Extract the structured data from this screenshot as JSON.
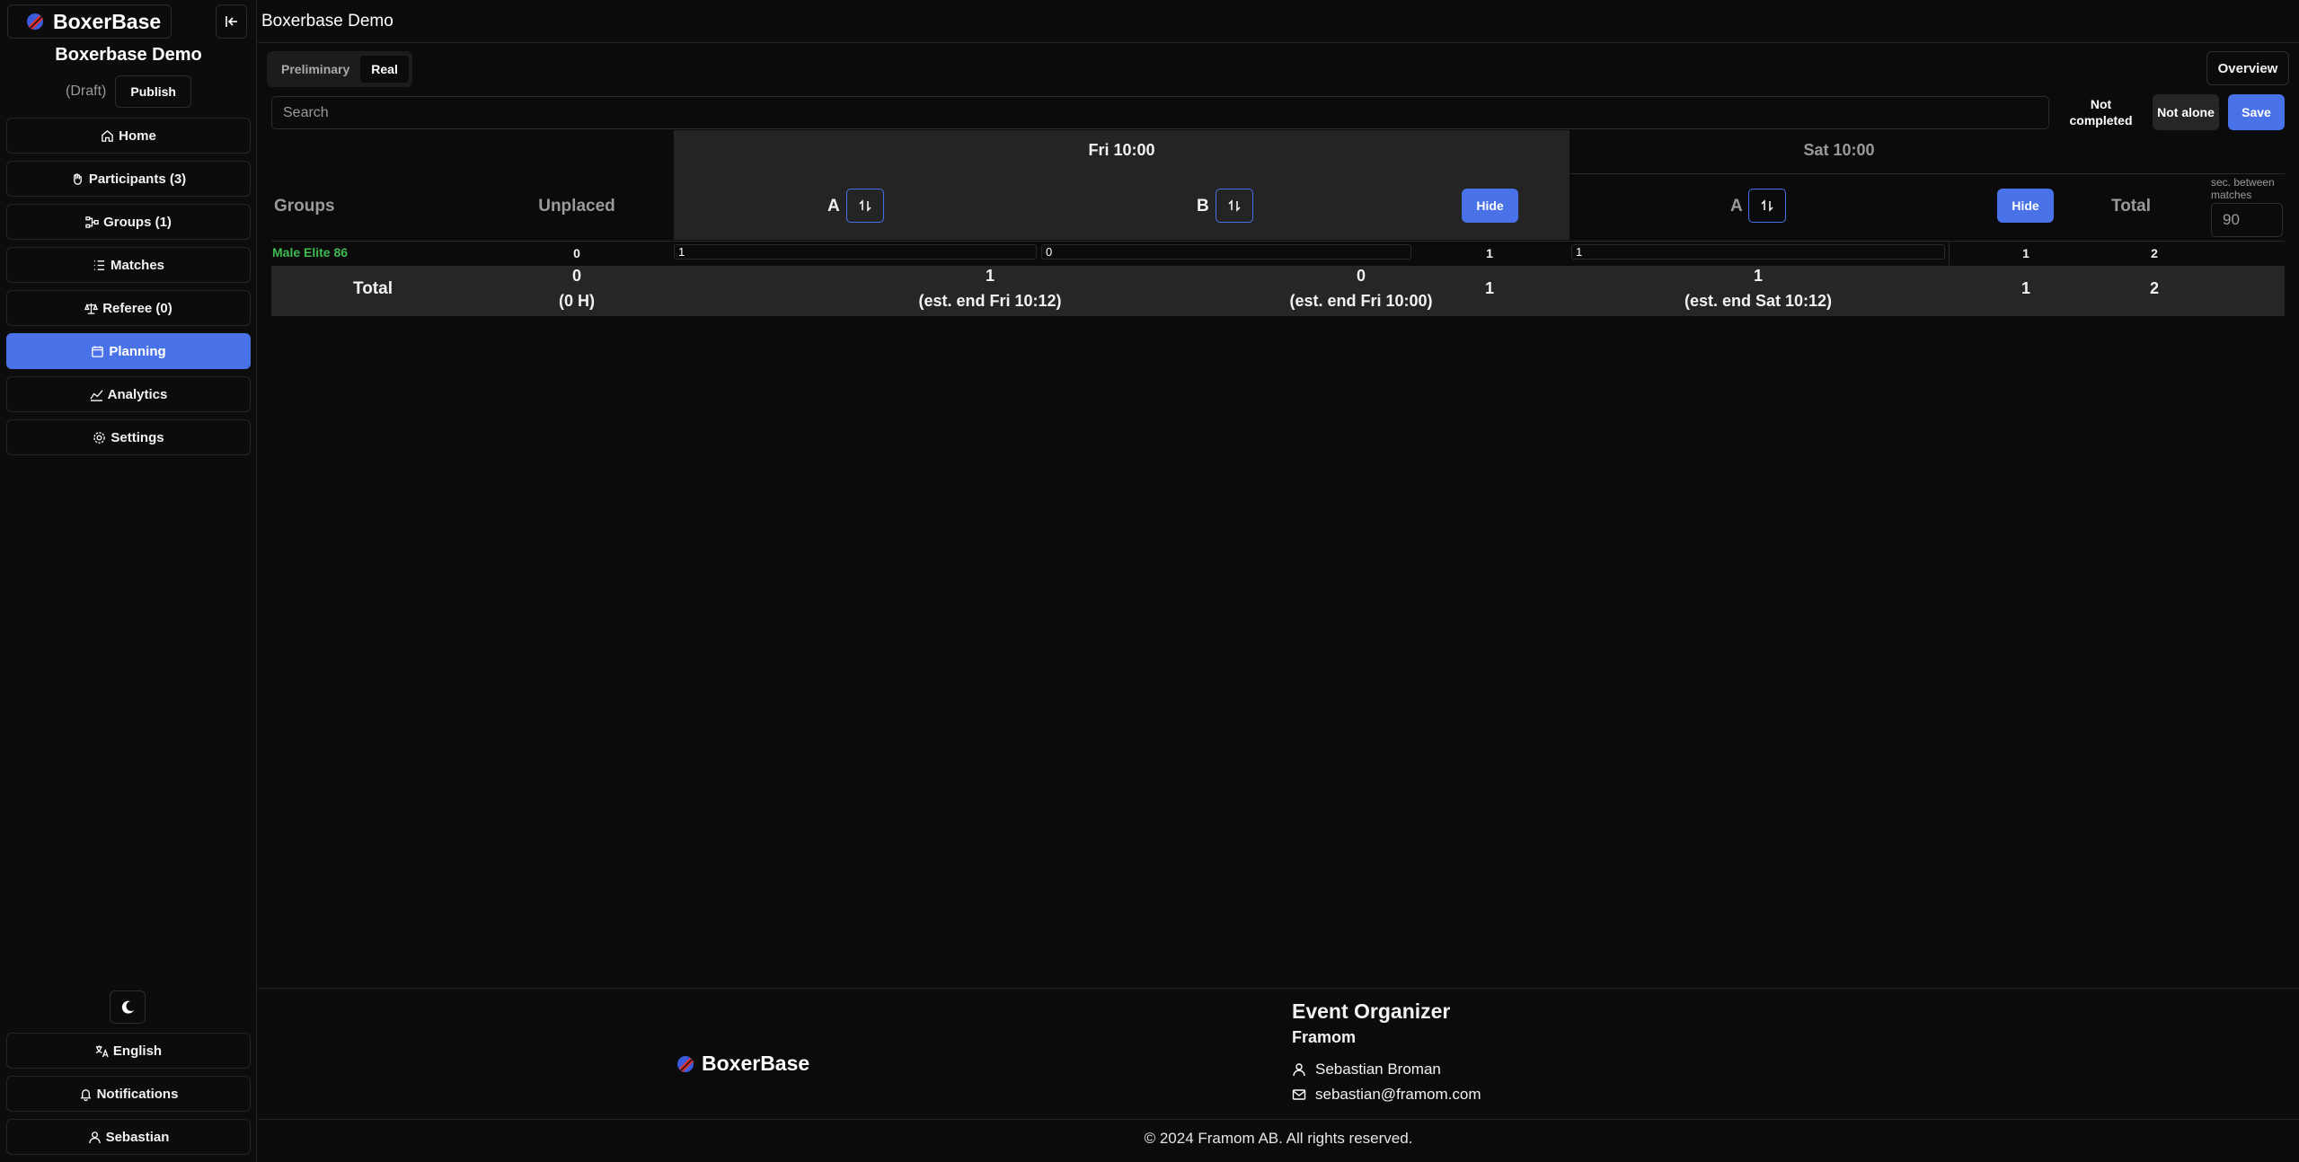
{
  "sidebar": {
    "brand": "BoxerBase",
    "event_title": "Boxerbase Demo",
    "draft_label": "(Draft)",
    "publish_label": "Publish",
    "items": [
      {
        "label": "Home",
        "icon": "home-icon"
      },
      {
        "label": "Participants (3)",
        "icon": "hand-icon"
      },
      {
        "label": "Groups (1)",
        "icon": "groups-icon"
      },
      {
        "label": "Matches",
        "icon": "list-icon"
      },
      {
        "label": "Referee (0)",
        "icon": "scale-icon"
      },
      {
        "label": "Planning",
        "icon": "calendar-icon",
        "active": true
      },
      {
        "label": "Analytics",
        "icon": "chart-line-icon"
      },
      {
        "label": "Settings",
        "icon": "gear-icon"
      }
    ],
    "bottom_items": [
      {
        "label": "English",
        "icon": "translate-icon"
      },
      {
        "label": "Notifications",
        "icon": "bell-icon"
      },
      {
        "label": "Sebastian",
        "icon": "user-icon"
      }
    ]
  },
  "header": {
    "title": "Boxerbase Demo"
  },
  "tabs": [
    {
      "label": "Preliminary",
      "active": false
    },
    {
      "label": "Real",
      "active": true
    }
  ],
  "overview_label": "Overview",
  "search": {
    "placeholder": "Search",
    "value": ""
  },
  "filters": {
    "not_completed": "Not completed",
    "not_alone": "Not alone",
    "save": "Save"
  },
  "grid": {
    "groups_header": "Groups",
    "unplaced_header": "Unplaced",
    "days": [
      {
        "label": "Fri 10:00",
        "rings": [
          "A",
          "B"
        ],
        "hide": "Hide"
      },
      {
        "label": "Sat 10:00",
        "rings": [
          "A"
        ],
        "hide": "Hide"
      }
    ],
    "total_header": "Total",
    "sec_between_label": "sec. between matches",
    "sec_between_value": "90",
    "rows": [
      {
        "group": "Male Elite 86",
        "unplaced": "0",
        "fri_a": "1",
        "fri_b": "0",
        "fri_total": "1",
        "sat_a": "1",
        "sat_total": "1",
        "total": "2"
      }
    ],
    "totals": {
      "label": "Total",
      "unplaced": "0",
      "unplaced_sub": "(0 H)",
      "fri_a": "1",
      "fri_a_sub": "(est. end Fri 10:12)",
      "fri_b": "0",
      "fri_b_sub": "(est. end Fri 10:00)",
      "fri_total": "1",
      "sat_a": "1",
      "sat_a_sub": "(est. end Sat 10:12)",
      "sat_total": "1",
      "total": "2"
    }
  },
  "footer": {
    "brand": "BoxerBase",
    "org_title": "Event Organizer",
    "org_name": "Framom",
    "contact_name": "Sebastian Broman",
    "contact_email": "sebastian@framom.com",
    "copyright": "© 2024 Framom AB. All rights reserved."
  },
  "colors": {
    "accent": "#4a72e8",
    "group_link": "#3fb950",
    "background": "#0b0b0b"
  }
}
